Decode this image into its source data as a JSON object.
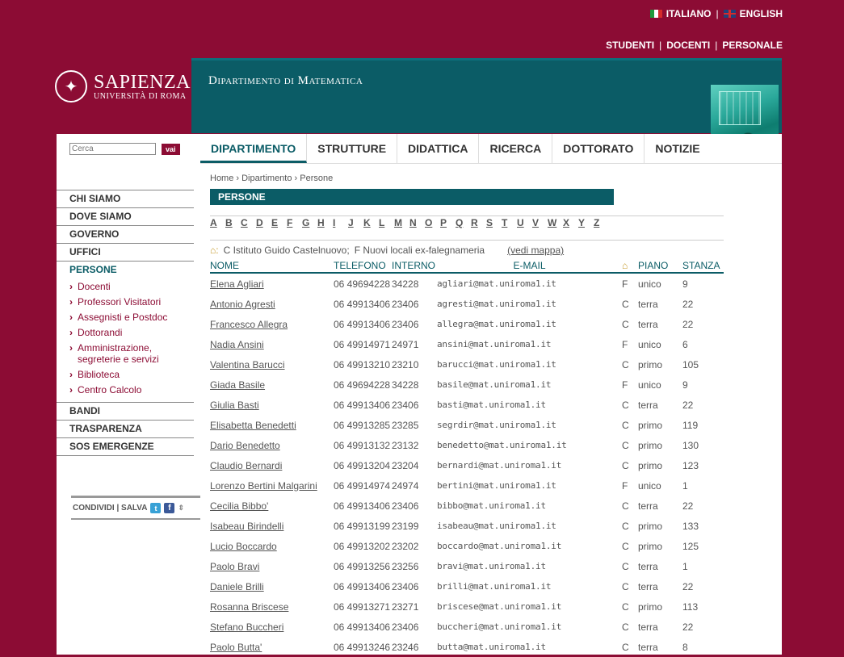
{
  "lang": {
    "italian": "ITALIANO",
    "english": "ENGLISH"
  },
  "roles": [
    "STUDENTI",
    "DOCENTI",
    "PERSONALE"
  ],
  "logo": {
    "name": "SAPIENZA",
    "subtitle": "UNIVERSITÀ DI ROMA"
  },
  "banner": {
    "title": "Dipartimento di Matematica"
  },
  "search": {
    "placeholder": "Cerca",
    "button": "vai"
  },
  "tabs": [
    "DIPARTIMENTO",
    "STRUTTURE",
    "DIDATTICA",
    "RICERCA",
    "DOTTORATO",
    "NOTIZIE"
  ],
  "nav": {
    "top": [
      "CHI SIAMO",
      "DOVE SIAMO",
      "GOVERNO",
      "UFFICI",
      "PERSONE"
    ],
    "sub": [
      "Docenti",
      "Professori Visitatori",
      "Assegnisti e Postdoc",
      "Dottorandi",
      "Amministrazione, segreterie e servizi",
      "Biblioteca",
      "Centro Calcolo"
    ],
    "bottom": [
      "BANDI",
      "TRASPARENZA",
      "SOS EMERGENZE"
    ]
  },
  "share": "CONDIVIDI | SALVA",
  "breadcrumb": "Home › Dipartimento › Persone",
  "section_title": "PERSONE",
  "alphabet": [
    "A",
    "B",
    "C",
    "D",
    "E",
    "F",
    "G",
    "H",
    "I",
    "J",
    "K",
    "L",
    "M",
    "N",
    "O",
    "P",
    "Q",
    "R",
    "S",
    "T",
    "U",
    "V",
    "W",
    "X",
    "Y",
    "Z"
  ],
  "legend": {
    "c": "C  Istituto Guido Castelnuovo;",
    "f": "F  Nuovi locali ex-falegnameria",
    "map": "(vedi mappa)"
  },
  "columns": {
    "name": "NOME",
    "phone": "TELEFONO",
    "ext": "INTERNO",
    "email": "E-MAIL",
    "floor": "PIANO",
    "room": "STANZA"
  },
  "people": [
    {
      "name": "Elena Agliari",
      "phone": "06 49694228",
      "ext": "34228",
      "email": "agliari@mat.uniroma1.it",
      "bld": "F",
      "floor": "unico",
      "room": "9"
    },
    {
      "name": "Antonio Agresti",
      "phone": "06 49913406",
      "ext": "23406",
      "email": "agresti@mat.uniroma1.it",
      "bld": "C",
      "floor": "terra",
      "room": "22"
    },
    {
      "name": "Francesco Allegra",
      "phone": "06 49913406",
      "ext": "23406",
      "email": "allegra@mat.uniroma1.it",
      "bld": "C",
      "floor": "terra",
      "room": "22"
    },
    {
      "name": "Nadia Ansini",
      "phone": "06 49914971",
      "ext": "24971",
      "email": "ansini@mat.uniroma1.it",
      "bld": "F",
      "floor": "unico",
      "room": "6"
    },
    {
      "name": "Valentina Barucci",
      "phone": "06 49913210",
      "ext": "23210",
      "email": "barucci@mat.uniroma1.it",
      "bld": "C",
      "floor": "primo",
      "room": "105"
    },
    {
      "name": "Giada Basile ",
      "phone": "06 49694228",
      "ext": "34228",
      "email": "basile@mat.uniroma1.it",
      "bld": "F",
      "floor": "unico",
      "room": "9"
    },
    {
      "name": "Giulia Basti",
      "phone": "06 49913406",
      "ext": "23406",
      "email": "basti@mat.uniroma1.it",
      "bld": "C",
      "floor": "terra",
      "room": "22"
    },
    {
      "name": "Elisabetta Benedetti",
      "phone": "06 49913285",
      "ext": "23285",
      "email": "segrdir@mat.uniroma1.it",
      "bld": "C",
      "floor": "primo",
      "room": "119"
    },
    {
      "name": "Dario Benedetto",
      "phone": "06 49913132",
      "ext": "23132",
      "email": "benedetto@mat.uniroma1.it",
      "bld": "C",
      "floor": "primo",
      "room": "130"
    },
    {
      "name": "Claudio Bernardi",
      "phone": "06 49913204",
      "ext": "23204",
      "email": "bernardi@mat.uniroma1.it",
      "bld": "C",
      "floor": "primo",
      "room": "123"
    },
    {
      "name": "Lorenzo Bertini Malgarini",
      "phone": "06 49914974",
      "ext": "24974",
      "email": "bertini@mat.uniroma1.it",
      "bld": "F",
      "floor": "unico",
      "room": "1"
    },
    {
      "name": "Cecilia Bibbo'",
      "phone": "06 49913406",
      "ext": "23406",
      "email": "bibbo@mat.uniroma1.it",
      "bld": "C",
      "floor": "terra",
      "room": "22"
    },
    {
      "name": "Isabeau Birindelli",
      "phone": "06 49913199",
      "ext": "23199",
      "email": "isabeau@mat.uniroma1.it",
      "bld": "C",
      "floor": "primo",
      "room": "133"
    },
    {
      "name": "Lucio Boccardo",
      "phone": "06 49913202",
      "ext": "23202",
      "email": "boccardo@mat.uniroma1.it",
      "bld": "C",
      "floor": "primo",
      "room": "125"
    },
    {
      "name": "Paolo Bravi",
      "phone": "06 49913256",
      "ext": "23256",
      "email": "bravi@mat.uniroma1.it",
      "bld": "C",
      "floor": "terra",
      "room": "1"
    },
    {
      "name": "Daniele Brilli",
      "phone": "06 49913406",
      "ext": "23406",
      "email": "brilli@mat.uniroma1.it",
      "bld": "C",
      "floor": "terra",
      "room": "22"
    },
    {
      "name": "Rosanna Briscese",
      "phone": "06 49913271",
      "ext": "23271",
      "email": "briscese@mat.uniroma1.it",
      "bld": "C",
      "floor": "primo",
      "room": "113"
    },
    {
      "name": "Stefano Buccheri",
      "phone": "06 49913406",
      "ext": "23406",
      "email": "buccheri@mat.uniroma1.it",
      "bld": "C",
      "floor": "terra",
      "room": "22"
    },
    {
      "name": "Paolo Butta'",
      "phone": "06 49913246",
      "ext": "23246",
      "email": "butta@mat.uniroma1.it",
      "bld": "C",
      "floor": "terra",
      "room": "8"
    }
  ]
}
